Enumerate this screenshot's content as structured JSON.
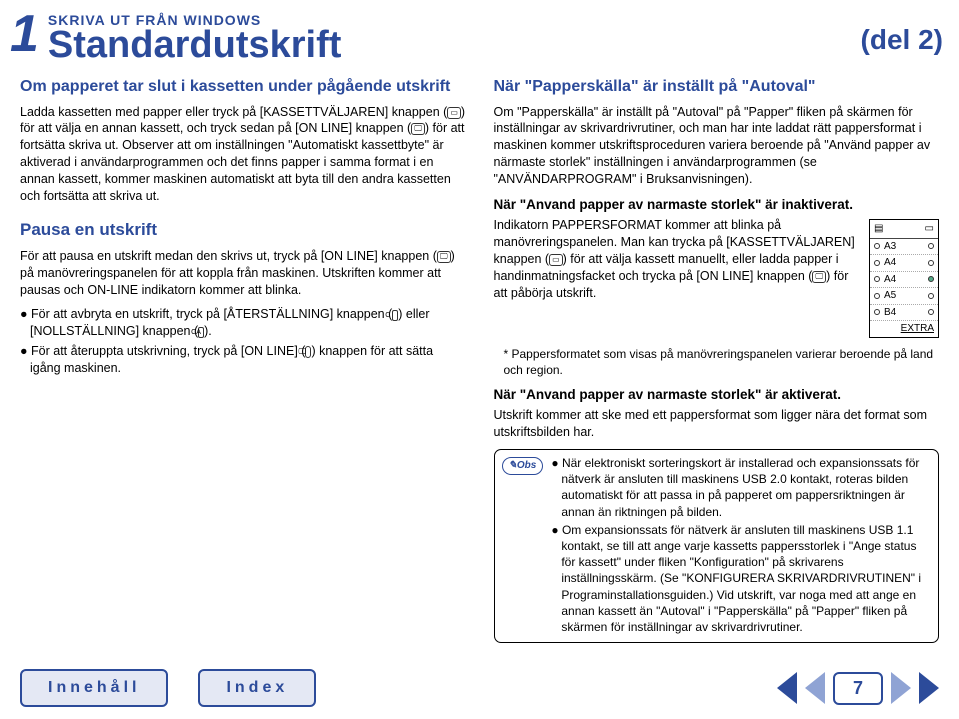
{
  "header": {
    "overline": "SKRIVA UT FRÅN WINDOWS",
    "title": "Standardutskrift",
    "part": "(del 2)",
    "chapter_num": "1"
  },
  "left": {
    "h1": "Om papperet tar slut i kassetten under pågående utskrift",
    "p1a": "Ladda kassetten med papper eller tryck på [KASSETTVÄLJAREN] knappen (",
    "p1b": ") för att välja en annan kassett, och tryck sedan på [ON LINE] knappen (",
    "p1c": ") för att fortsätta skriva ut. Observer att om inställningen \"Automatiskt kassettbyte\" är aktiverad i användarprogrammen och det finns papper i samma format i en annan kassett, kommer maskinen automatiskt att byta till den andra kassetten och fortsätta att skriva ut.",
    "h2": "Pausa en utskrift",
    "p2a": "För att pausa en utskrift medan den skrivs ut, tryck på [ON LINE] knappen (",
    "p2b": ") på manövreringspanelen för att koppla från maskinen. Utskriften kommer att pausas och ON-LINE indikatorn kommer att blinka.",
    "b1a": "För att avbryta en utskrift, tryck på [ÅTERSTÄLLNING] knappen (",
    "b1b": ") eller [NOLLSTÄLLNING] knappen (",
    "b1c": ").",
    "b2a": "För att återuppta utskrivning, tryck på [ON LINE] (",
    "b2b": ") knappen för att sätta igång maskinen."
  },
  "right": {
    "h1": "När \"Papperskälla\" är inställt på \"Autoval\"",
    "p1": "Om \"Papperskälla\" är inställt på \"Autoval\" på \"Papper\" fliken på skärmen för inställningar av skrivardrivrutiner, och man har inte laddat rätt pappersformat i maskinen kommer utskriftsproceduren variera beroende på \"Använd papper av närmaste storlek\" inställningen i användarprogrammen (se \"ANVÄNDARPROGRAM\" i Bruksanvisningen).",
    "h2": "När \"Anvand papper av narmaste storlek\" är inaktiverat.",
    "p2a": "Indikatorn PAPPERSFORMAT kommer att blinka på manövreringspanelen. Man kan trycka på [KASSETTVÄLJAREN] knappen (",
    "p2b": ") för att välja kassett manuellt, eller ladda papper i handinmatningsfacket och trycka på [ON LINE] knappen (",
    "p2c": ") för att påbörja utskrift.",
    "note_ast": "* Pappersformatet som visas på manövreringspanelen varierar beroende på land och region.",
    "h3": "När \"Anvand papper av narmaste storlek\" är aktiverat.",
    "p3": "Utskrift kommer att ske med ett pappersformat som ligger nära det format som utskriftsbilden har.",
    "obs_label": "Obs",
    "obs_b1": "När elektroniskt sorteringskort är installerad och expansionssats för nätverk är ansluten till maskinens USB 2.0 kontakt, roteras bilden automatiskt för att passa in på papperet om pappersriktningen är annan än riktningen på bilden.",
    "obs_b2": "Om expansionssats för nätverk är ansluten till maskinens USB 1.1 kontakt, se till att ange varje kassetts pappersstorlek i \"Ange status för kassett\" under fliken \"Konfiguration\" på skrivarens inställningsskärm. (Se \"KONFIGURERA SKRIVARDRIVRUTINEN\" i Programinstallationsguiden.) Vid utskrift, var noga med att ange en annan kassett än \"Autoval\" i \"Papperskälla\" på \"Papper\" fliken på skärmen för inställningar av skrivardrivrutiner."
  },
  "paper_sizes": {
    "rows": [
      {
        "label": "A3",
        "on": false
      },
      {
        "label": "A4",
        "on": false
      },
      {
        "label": "A4",
        "on": true
      },
      {
        "label": "A5",
        "on": false
      },
      {
        "label": "B4",
        "on": false
      }
    ],
    "extra": "EXTRA"
  },
  "footer": {
    "contents": "Innehåll",
    "index": "Index",
    "page": "7"
  },
  "icons": {
    "tray": "▭",
    "online": "🖵",
    "c_key": "C",
    "ca_key": "CA",
    "pencil": "✎"
  }
}
